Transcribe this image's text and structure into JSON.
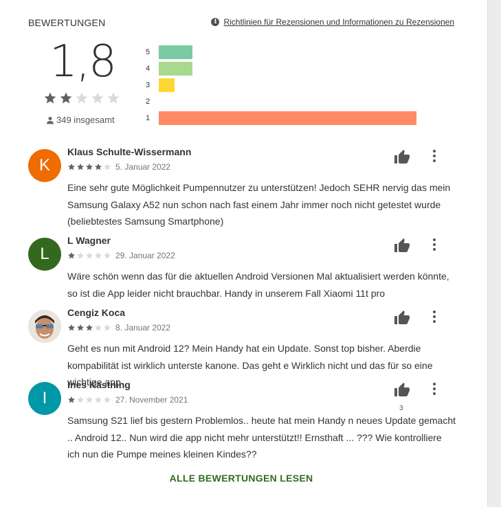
{
  "header": {
    "title": "BEWERTUNGEN",
    "policy_link": "Richtlinien für Rezensionen und Informationen zu Rezensionen"
  },
  "summary": {
    "score": "1,8",
    "stars": 2,
    "total": "349 insgesamt"
  },
  "histogram": [
    {
      "label": "5",
      "fraction": 0.13,
      "color": "#7bcba2"
    },
    {
      "label": "4",
      "fraction": 0.13,
      "color": "#a8d98f"
    },
    {
      "label": "3",
      "fraction": 0.06,
      "color": "#fdd835"
    },
    {
      "label": "2",
      "fraction": 0.0,
      "color": "#ffb74d"
    },
    {
      "label": "1",
      "fraction": 1.0,
      "color": "#ff8a65"
    }
  ],
  "reviews": [
    {
      "author": "Klaus Schulte-Wissermann",
      "initial": "K",
      "avatar_color": "#ef6c00",
      "stars": 4,
      "date": "5. Januar 2022",
      "text": "Eine sehr gute Möglichkeit Pumpennutzer zu unterstützen! Jedoch SEHR nervig das mein Samsung Galaxy A52 nun schon nach fast einem Jahr immer noch nicht getestet wurde (beliebtestes Samsung Smartphone)"
    },
    {
      "author": "L Wagner",
      "initial": "L",
      "avatar_color": "#33691e",
      "stars": 1,
      "date": "29. Januar 2022",
      "text": "Wäre schön wenn das für die aktuellen Android Versionen Mal aktualisiert werden könnte, so ist die App leider nicht brauchbar. Handy in unserem Fall Xiaomi 11t pro"
    },
    {
      "author": "Cengiz Koca",
      "initial": "",
      "avatar_color": "#d8d8d8",
      "stars": 3,
      "date": "8. Januar 2022",
      "text": "Geht es nun mit Android 12? Mein Handy hat ein Update. Sonst top bisher. Aberdie kompabilität ist wirklich unterste kanone. Das geht e Wirklich nicht und das für so eine wichtige app"
    },
    {
      "author": "Ines Kastning",
      "initial": "I",
      "avatar_color": "#0097a7",
      "stars": 1,
      "date": "27. November 2021",
      "text": "Samsung S21 lief bis gestern Problemlos.. heute hat mein Handy n neues Update gemacht .. Android 12.. Nun wird die app nicht mehr unterstützt!! Ernsthaft ... ??? Wie kontrolliere ich nun die Pumpe meines kleinen Kindes??",
      "likes": "3"
    }
  ],
  "footer": {
    "all_reviews": "ALLE BEWERTUNGEN LESEN"
  },
  "icons": {
    "info": "info-icon",
    "person": "person-icon",
    "thumb": "thumbs-up-icon",
    "more": "more-vert-icon"
  }
}
